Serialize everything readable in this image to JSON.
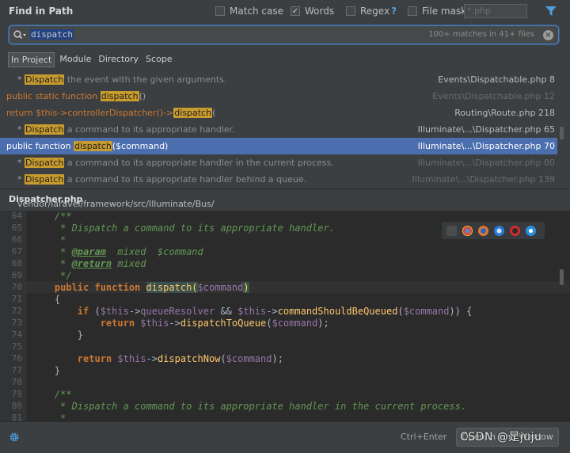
{
  "header": {
    "title": "Find in Path",
    "options": [
      {
        "label": "Match case",
        "checked": false
      },
      {
        "label": "Words",
        "checked": true
      },
      {
        "label": "Regex",
        "checked": false,
        "help": "?"
      },
      {
        "label": "File mask:",
        "checked": false
      }
    ],
    "file_mask_placeholder": "*.php",
    "accent_color": "#4e9fde"
  },
  "search": {
    "query": "dispatch",
    "match_count": "100+ matches in 41+ files"
  },
  "scope_tabs": [
    {
      "label": "In Project",
      "active": true
    },
    {
      "label": "Module",
      "active": false
    },
    {
      "label": "Directory",
      "active": false
    },
    {
      "label": "Scope",
      "active": false
    }
  ],
  "results": [
    {
      "pre": "* ",
      "match": "Dispatch",
      "post": " the event with the given arguments.",
      "file": "Events\\Dispatchable.php 8",
      "dim": false,
      "style": "comment"
    },
    {
      "pre": "public static function ",
      "match": "dispatch",
      "post": "()",
      "file": "Events\\Dispatchable.php 12",
      "dim": true,
      "style": "code"
    },
    {
      "pre": "return $this->controllerDispatcher()->",
      "match": "dispatch",
      "post": "(",
      "file": "Routing\\Route.php 218",
      "dim": false,
      "style": "code"
    },
    {
      "pre": "* ",
      "match": "Dispatch",
      "post": " a command to its appropriate handler.",
      "file": "Illuminate\\...\\Dispatcher.php 65",
      "dim": false,
      "style": "comment"
    },
    {
      "pre": "public function ",
      "match": "dispatch",
      "post": "($command)",
      "file": "Illuminate\\...\\Dispatcher.php 70",
      "dim": false,
      "style": "code",
      "selected": true
    },
    {
      "pre": "* ",
      "match": "Dispatch",
      "post": " a command to its appropriate handler in the current process.",
      "file": "Illuminate\\...\\Dispatcher.php 80",
      "dim": true,
      "style": "comment"
    },
    {
      "pre": "* ",
      "match": "Dispatch",
      "post": " a command to its appropriate handler behind a queue.",
      "file": "Illuminate\\...\\Dispatcher.php 139",
      "dim": true,
      "style": "comment"
    }
  ],
  "path": {
    "dir": "vendor/laravel/framework/src/Illuminate/Bus/",
    "file": "Dispatcher.php"
  },
  "editor": {
    "line_numbers": [
      "64",
      "65",
      "66",
      "67",
      "68",
      "69",
      "70",
      "71",
      "72",
      "73",
      "74",
      "75",
      "76",
      "77",
      "78",
      "79",
      "80",
      "81"
    ],
    "current_line": "70",
    "browser_icons": [
      "chrome",
      "firefox",
      "safari",
      "opera",
      "ie",
      "edge"
    ]
  },
  "footer": {
    "shortcut": "Ctrl+Enter",
    "open_button": "Open in Find Window",
    "watermark": "CSDN @是juju"
  }
}
